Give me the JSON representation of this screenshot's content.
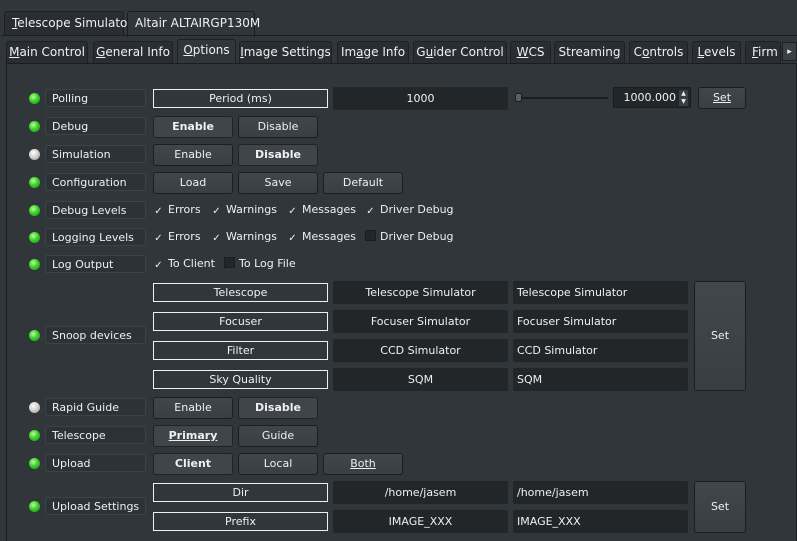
{
  "device_tabs": [
    {
      "label": "Telescope Simulator",
      "mnemonic": "T",
      "rest": "elescope Simulator"
    },
    {
      "label": "Altair ALTAIRGP130M"
    }
  ],
  "property_tabs": [
    {
      "label": "Main Control",
      "m": "M",
      "r": "ain Control"
    },
    {
      "label": "General Info",
      "m": "G",
      "r": "eneral Info"
    },
    {
      "label": "Options",
      "m": "O",
      "r": "ptions"
    },
    {
      "label": "Image Settings",
      "m": "I",
      "r": "mage Settings"
    },
    {
      "label": "Image Info",
      "pre": "Im",
      "m": "a",
      "r": "ge Info"
    },
    {
      "label": "Guider Control",
      "pre": "G",
      "m": "u",
      "r": "ider Control"
    },
    {
      "label": "WCS",
      "m": "W",
      "r": "CS"
    },
    {
      "label": "Streaming"
    },
    {
      "label": "Controls",
      "pre": "C",
      "m": "o",
      "r": "ntrols"
    },
    {
      "label": "Levels",
      "m": "L",
      "r": "evels"
    },
    {
      "label": "Firm",
      "m": "F",
      "r": "irm"
    }
  ],
  "icons": {
    "scroll_right": "▸",
    "check": "✓",
    "spin_up": "▲",
    "spin_down": "▼"
  },
  "colors": {
    "led_ok": "#3ad12a",
    "led_idle": "#c8c8c8",
    "background": "#31363b"
  },
  "polling": {
    "label": "Polling",
    "field": "Period (ms)",
    "value": "1000",
    "spin_value": "1000.000",
    "set": "Set",
    "slider_fraction": 0.0
  },
  "debug": {
    "label": "Debug",
    "enable": "Enable",
    "disable": "Disable"
  },
  "simulation": {
    "label": "Simulation",
    "enable": "Enable",
    "disable": "Disable"
  },
  "configuration": {
    "label": "Configuration",
    "load": "Load",
    "save": "Save",
    "default": "Default"
  },
  "debug_levels": {
    "label": "Debug Levels",
    "items": [
      "Errors",
      "Warnings",
      "Messages",
      "Driver Debug"
    ],
    "checked": [
      true,
      true,
      true,
      true
    ]
  },
  "logging_levels": {
    "label": "Logging Levels",
    "items": [
      "Errors",
      "Warnings",
      "Messages",
      "Driver Debug"
    ],
    "checked": [
      true,
      true,
      true,
      false
    ]
  },
  "log_output": {
    "label": "Log Output",
    "items": [
      "To Client",
      "To Log File"
    ],
    "checked": [
      true,
      false
    ]
  },
  "snoop": {
    "label": "Snoop devices",
    "rows": [
      {
        "name": "Telescope",
        "value": "Telescope Simulator",
        "input": "Telescope Simulator"
      },
      {
        "name": "Focuser",
        "value": "Focuser Simulator",
        "input": "Focuser Simulator"
      },
      {
        "name": "Filter",
        "value": "CCD Simulator",
        "input": "CCD Simulator"
      },
      {
        "name": "Sky Quality",
        "value": "SQM",
        "input": "SQM"
      }
    ],
    "set": "Set"
  },
  "rapid_guide": {
    "label": "Rapid Guide",
    "enable": "Enable",
    "disable": "Disable"
  },
  "telescope": {
    "label": "Telescope",
    "primary": "Primary",
    "guide": "Guide"
  },
  "upload": {
    "label": "Upload",
    "client": "Client",
    "local": "Local",
    "both": "Both"
  },
  "upload_settings": {
    "label": "Upload Settings",
    "rows": [
      {
        "name": "Dir",
        "value": "/home/jasem",
        "input": "/home/jasem"
      },
      {
        "name": "Prefix",
        "value": "IMAGE_XXX",
        "input": "IMAGE_XXX"
      }
    ],
    "set": "Set"
  }
}
